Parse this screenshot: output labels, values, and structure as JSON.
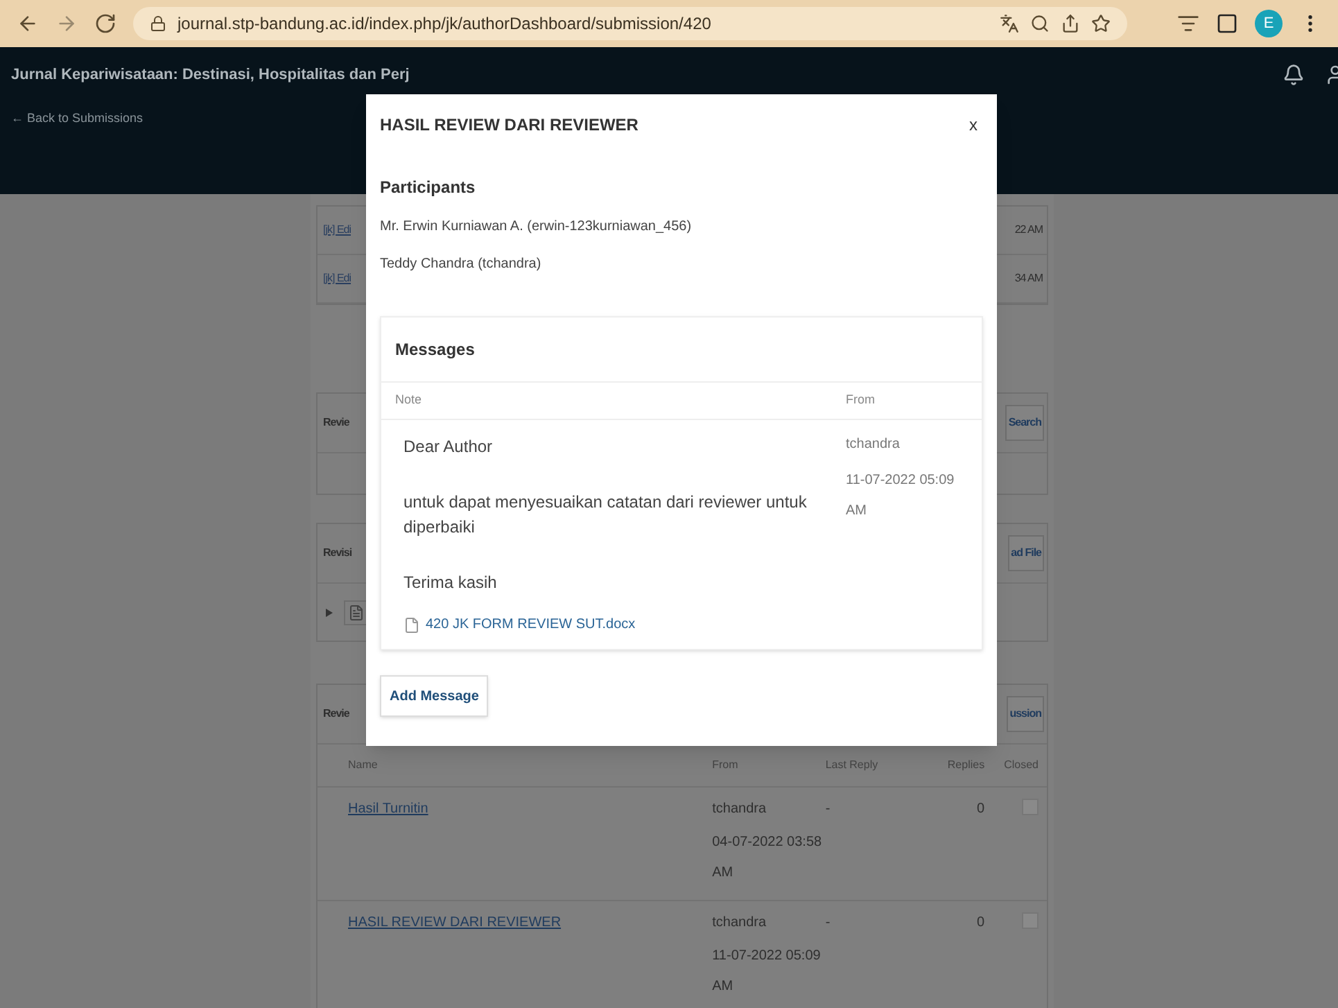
{
  "browser": {
    "url": "journal.stp-bandung.ac.id/index.php/jk/authorDashboard/submission/420",
    "profile_initial": "E"
  },
  "header": {
    "title": "Jurnal Kepariwisataan: Destinasi, Hospitalitas dan Perj",
    "back_link": "← Back to Submissions"
  },
  "background": {
    "file_rows": [
      {
        "name": "[jk] Edi",
        "time": "22 AM"
      },
      {
        "name": "[jk] Edi",
        "time": "34 AM"
      }
    ],
    "panels": [
      {
        "title": "Revie",
        "button": "Search"
      },
      {
        "title": "Revisi",
        "button": "ad File"
      },
      {
        "title": "Revie",
        "button": "ussion"
      }
    ],
    "table": {
      "columns": [
        "Name",
        "From",
        "Last Reply",
        "Replies",
        "Closed"
      ],
      "rows": [
        {
          "name": "Hasil Turnitin",
          "from": "tchandra",
          "date": "04-07-2022 03:58 AM",
          "last_reply": "-",
          "replies": "0",
          "closed": false
        },
        {
          "name": "HASIL REVIEW DARI REVIEWER",
          "from": "tchandra",
          "date": "11-07-2022 05:09 AM",
          "last_reply": "-",
          "replies": "0",
          "closed": false
        }
      ]
    }
  },
  "modal": {
    "title": "HASIL REVIEW DARI REVIEWER",
    "close": "x",
    "participants_heading": "Participants",
    "participants": [
      "Mr. Erwin Kurniawan A. (erwin-123kurniawan_456)",
      "Teddy Chandra (tchandra)"
    ],
    "messages_heading": "Messages",
    "columns": [
      "Note",
      "From"
    ],
    "message": {
      "paragraphs": [
        "Dear Author",
        "untuk dapat menyesuaikan catatan dari reviewer untuk diperbaiki",
        "Terima kasih"
      ],
      "attachment": "420 JK FORM REVIEW SUT.docx",
      "from": "tchandra",
      "date": "11-07-2022 05:09 AM"
    },
    "add_button": "Add Message"
  }
}
